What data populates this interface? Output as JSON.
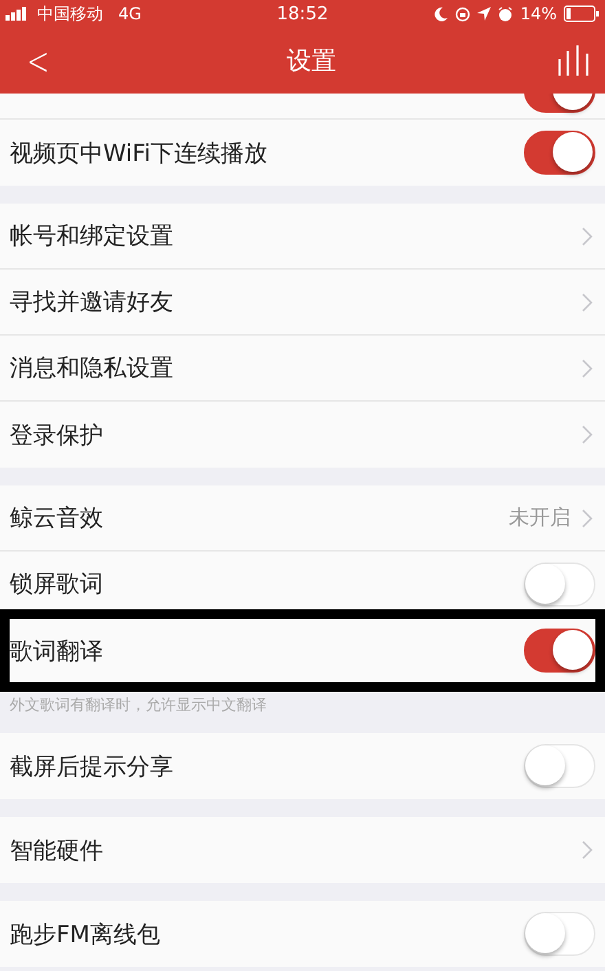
{
  "status_bar": {
    "carrier": "中国移动",
    "network": "4G",
    "time": "18:52",
    "battery_text": "14%"
  },
  "nav": {
    "back": "<",
    "title": "设置"
  },
  "sections": [
    {
      "items": [
        {
          "kind": "toggle",
          "on": true,
          "partial": true
        },
        {
          "kind": "toggle",
          "label": "视频页中WiFi下连续播放",
          "on": true
        }
      ]
    },
    {
      "items": [
        {
          "kind": "link",
          "label": "帐号和绑定设置"
        },
        {
          "kind": "link",
          "label": "寻找并邀请好友"
        },
        {
          "kind": "link",
          "label": "消息和隐私设置"
        },
        {
          "kind": "link",
          "label": "登录保护"
        }
      ]
    },
    {
      "items": [
        {
          "kind": "link",
          "label": "鲸云音效",
          "value": "未开启"
        },
        {
          "kind": "toggle",
          "label": "锁屏歌词",
          "on": false
        },
        {
          "kind": "toggle",
          "label": "歌词翻译",
          "on": true,
          "highlighted": true
        }
      ],
      "footnote": "外文歌词有翻译时，允许显示中文翻译"
    },
    {
      "items": [
        {
          "kind": "toggle",
          "label": "截屏后提示分享",
          "on": false
        }
      ]
    },
    {
      "items": [
        {
          "kind": "link",
          "label": "智能硬件"
        }
      ]
    },
    {
      "items": [
        {
          "kind": "toggle",
          "label": "跑步FM离线包",
          "on": false
        }
      ]
    }
  ]
}
